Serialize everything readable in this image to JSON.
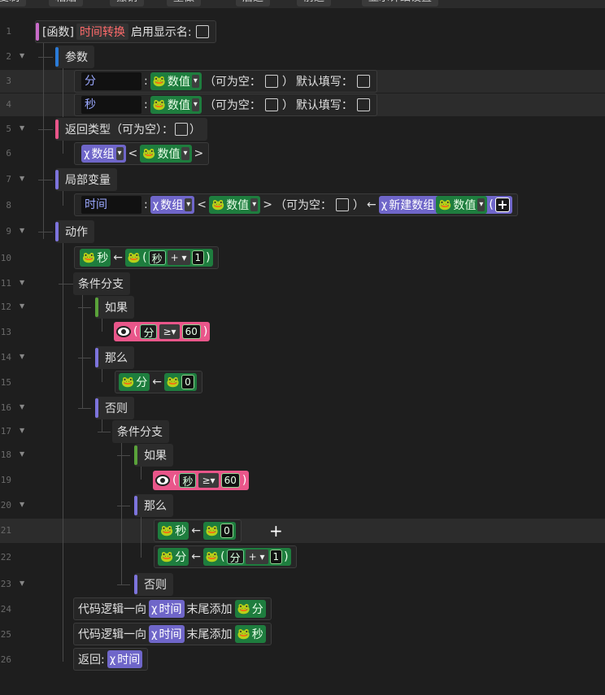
{
  "toolbar": {
    "b1": "复制",
    "b2": "粘贴",
    "b3": "撤销",
    "b4": "重做",
    "b5": "后退",
    "b6": "前进",
    "b7": "显示详细设置"
  },
  "lines": [
    "1",
    "2",
    "3",
    "4",
    "5",
    "6",
    "7",
    "8",
    "9",
    "10",
    "11",
    "12",
    "13",
    "14",
    "15",
    "16",
    "17",
    "18",
    "19",
    "20",
    "21",
    "22",
    "23",
    "24",
    "25",
    "26"
  ],
  "func": {
    "kind": "[函数]",
    "name": "时间转换",
    "show": "启用显示名:"
  },
  "labels": {
    "params": "参数",
    "ret": "返回类型（可为空）：",
    "locals": "局部变量",
    "actions": "动作",
    "branch": "条件分支",
    "if": "如果",
    "then": "那么",
    "else": "否则"
  },
  "param1": {
    "name": "分",
    "type": "数值",
    "nullable": "（可为空：",
    "close": "）",
    "default": "默认填写："
  },
  "param2": {
    "name": "秒",
    "type": "数值",
    "nullable": "（可为空：",
    "close": "）",
    "default": "默认填写："
  },
  "ret": {
    "arr": "数组",
    "lt": "<",
    "type": "数值",
    "gt": ">"
  },
  "local": {
    "name": "时间",
    "arr": "数组",
    "lt": "<",
    "type": "数值",
    "gt": ">",
    "nullable": "（可为空：",
    "close": "）",
    "arrow": "←",
    "newarr": "新建数组",
    "ntype": "数值",
    "paren": "("
  },
  "s10": {
    "v": "秒",
    "arrow": "←",
    "inner": "秒",
    "op": "+",
    "num": "1"
  },
  "s13": {
    "v": "分",
    "op": "≥",
    "num": "60"
  },
  "s15": {
    "v": "分",
    "arrow": "←",
    "num": "0"
  },
  "s19": {
    "v": "秒",
    "op": "≥",
    "num": "60"
  },
  "s21": {
    "v": "秒",
    "arrow": "←",
    "num": "0"
  },
  "s22": {
    "v": "分",
    "arrow": "←",
    "inner": "分",
    "op": "+",
    "num": "1"
  },
  "s24": {
    "pre": "代码逻辑一向",
    "arr": "时间",
    "mid": "末尾添加",
    "v": "分"
  },
  "s25": {
    "pre": "代码逻辑一向",
    "arr": "时间",
    "mid": "末尾添加",
    "v": "秒"
  },
  "s26": {
    "pre": "返回:",
    "arr": "时间"
  },
  "icons": {
    "var": "frog-icon",
    "arr": "chi-icon",
    "cond": "eye-icon",
    "dropdown": "chevron-down-icon",
    "add": "plus-icon"
  }
}
